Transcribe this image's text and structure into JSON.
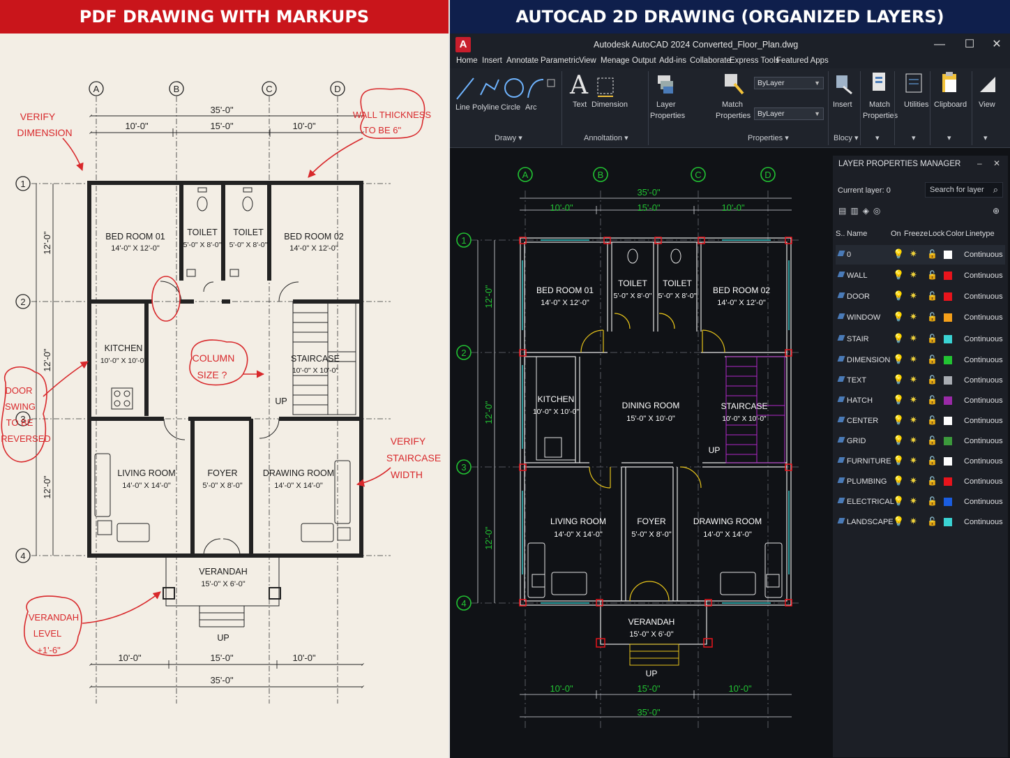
{
  "banners": {
    "left": "PDF DRAWING WITH MARKUPS",
    "right": "AUTOCAD 2D DRAWING (ORGANIZED LAYERS)"
  },
  "pdf": {
    "grid_columns": [
      "A",
      "B",
      "C",
      "D"
    ],
    "grid_rows": [
      "1",
      "2",
      "3",
      "4"
    ],
    "dims": {
      "overall_top": "35'-0\"",
      "top_a": "10'-0\"",
      "top_b": "15'-0\"",
      "top_c": "10'-0\"",
      "bot_a": "10'-0\"",
      "bot_b": "15'-0\"",
      "bot_c": "10'-0\"",
      "overall_bottom": "35'-0\"",
      "side_1": "12'-0\"",
      "side_2": "12'-0\"",
      "side_3": "12'-0\""
    },
    "rooms": {
      "bed1_name": "BED ROOM 01",
      "bed1_size": "14'-0\" X 12'-0\"",
      "toilet1_name": "TOILET",
      "toilet1_size": "5'-0\" X 8'-0\"",
      "toilet2_name": "TOILET",
      "toilet2_size": "5'-0\" X 8'-0\"",
      "bed2_name": "BED ROOM 02",
      "bed2_size": "14'-0\" X 12'-0\"",
      "kitchen_name": "KITCHEN",
      "kitchen_size": "10'-0\" X 10'-0\"",
      "stair_name": "STAIRCASE",
      "stair_size": "10'-0\" X 10'-0\"",
      "up1": "UP",
      "living_name": "LIVING ROOM",
      "living_size": "14'-0\" X 14'-0\"",
      "foyer_name": "FOYER",
      "foyer_size": "5'-0\" X 8'-0\"",
      "drawing_name": "DRAWING ROOM",
      "drawing_size": "14'-0\" X 14'-0\"",
      "verandah_name": "VERANDAH",
      "verandah_size": "15'-0\" X 6'-0\"",
      "up2": "UP"
    },
    "markups": {
      "verify_dim_1": "VERIFY",
      "verify_dim_2": "DIMENSION",
      "wall_1": "WALL THICKNESS",
      "wall_2": "TO BE 6\"",
      "column_1": "COLUMN",
      "column_2": "SIZE ?",
      "door_1": "DOOR",
      "door_2": "SWING",
      "door_3": "TO BE",
      "door_4": "REVERSED",
      "stair_1": "VERIFY",
      "stair_2": "STAIRCASE",
      "stair_3": "WIDTH",
      "ver_1": "VERANDAH",
      "ver_2": "LEVEL",
      "ver_3": "+1'-6\""
    }
  },
  "app": {
    "logo": "A",
    "title": "Autodesk AutoCAD 2024   Converted_Floor_Plan.dwg",
    "window_minimize": "—",
    "window_maximize": "☐",
    "window_close": "✕",
    "menu": [
      "Home",
      "Insert",
      "Annotate",
      "Parametric",
      "View",
      "Menage",
      "Output",
      "Add-ins",
      "Collaborate",
      "Express Tools",
      "Featured Apps"
    ],
    "ribbon": {
      "line": "Line",
      "polyline": "Polyline",
      "circle": "Circle",
      "arc": "Arc",
      "draw_group": "Drawy ▾",
      "text": "Text",
      "dimension": "Dimension",
      "annotation_group": "Annoltation ▾",
      "layer_props_1": "Layer",
      "layer_props_2": "Properties",
      "match_props_1": "Match",
      "match_props_2": "Properties",
      "bylayer_1": "ByLayer",
      "bylayer_2": "ByLayer",
      "properties_group": "Properties ▾",
      "insert": "Insert",
      "block_group": "Blocy ▾",
      "match2_1": "Match",
      "match2_2": "Properties",
      "utilities": "Utilities",
      "clipboard": "Clipboard",
      "view": "View"
    },
    "layer_panel": {
      "title": "LAYER PROPERTIES MANAGER",
      "close": "✕",
      "collapse": "–",
      "current_layer": "Current layer: 0",
      "search_placeholder": "Search for layer",
      "headers": {
        "status": "S..",
        "name": "Name",
        "on": "On",
        "freeze": "Freeze",
        "lock": "Lock",
        "color": "Color",
        "linetype": "Linetype"
      },
      "layers": [
        {
          "name": "0",
          "color": "#ffffff",
          "linetype": "Continuous"
        },
        {
          "name": "WALL",
          "color": "#e8141c",
          "linetype": "Continuous"
        },
        {
          "name": "DOOR",
          "color": "#e8141c",
          "linetype": "Continuous"
        },
        {
          "name": "WINDOW",
          "color": "#f5a01a",
          "linetype": "Continuous"
        },
        {
          "name": "STAIR",
          "color": "#3ad3d3",
          "linetype": "Continuous"
        },
        {
          "name": "DIMENSION",
          "color": "#22c433",
          "linetype": "Continuous"
        },
        {
          "name": "TEXT",
          "color": "#a9adb3",
          "linetype": "Continuous"
        },
        {
          "name": "HATCH",
          "color": "#9a2aa8",
          "linetype": "Continuous"
        },
        {
          "name": "CENTER",
          "color": "#ffffff",
          "linetype": "Continuous"
        },
        {
          "name": "GRID",
          "color": "#3c9a3c",
          "linetype": "Continuous"
        },
        {
          "name": "FURNITURE",
          "color": "#ffffff",
          "linetype": "Continuous"
        },
        {
          "name": "PLUMBING",
          "color": "#e8141c",
          "linetype": "Continuous"
        },
        {
          "name": "ELECTRICAL",
          "color": "#1a5de0",
          "linetype": "Continuous"
        },
        {
          "name": "LANDSCAPE",
          "color": "#3ad3d3",
          "linetype": "Continuous"
        }
      ]
    },
    "cad": {
      "grid_columns": [
        "A",
        "B",
        "C",
        "D"
      ],
      "grid_rows": [
        "1",
        "2",
        "3",
        "4"
      ],
      "dims": {
        "overall_top": "35'-0\"",
        "top_a": "10'-0\"",
        "top_b": "15'-0\"",
        "top_c": "10'-0\"",
        "side_1": "12'-0\"",
        "side_2": "12'-0\"",
        "side_3": "12'-0\"",
        "bot_a": "10'-0\"",
        "bot_b": "15'-0\"",
        "bot_c": "10'-0\"",
        "overall_bottom": "35'-0\""
      },
      "rooms": {
        "bed1_name": "BED ROOM 01",
        "bed1_size": "14'-0\" X 12'-0\"",
        "toilet1_name": "TOILET",
        "toilet1_size": "5'-0\" X 8'-0\"",
        "toilet2_name": "TOILET",
        "toilet2_size": "5'-0\" X 8'-0\"",
        "bed2_name": "BED ROOM 02",
        "bed2_size": "14'-0\" X 12'-0\"",
        "kitchen_name": "KITCHEN",
        "kitchen_size": "10'-0\" X 10'-0\"",
        "dining_name": "DINING ROOM",
        "dining_size": "15'-0\" X 10'-0\"",
        "stair_name": "STAIRCASE",
        "stair_size": "10'-0\" X 10'-0\"",
        "up1": "UP",
        "living_name": "LIVING ROOM",
        "living_size": "14'-0\" X 14'-0\"",
        "foyer_name": "FOYER",
        "foyer_size": "5'-0\" X 8'-0\"",
        "drawing_name": "DRAWING ROOM",
        "drawing_size": "14'-0\" X 14'-0\"",
        "verandah_name": "VERANDAH",
        "verandah_size": "15'-0\" X 6'-0\"",
        "up2": "UP"
      }
    }
  }
}
